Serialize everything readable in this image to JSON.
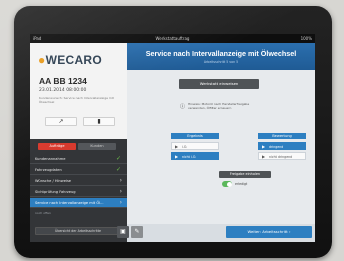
{
  "statusbar": {
    "left": "iPad",
    "center": "Werkstattauftrag",
    "right": "100%"
  },
  "sidebar": {
    "logo_dot": "●",
    "logo_text": "WECARO",
    "plate": "AA BB 1234",
    "date": "23.01.2014 08:00:00",
    "info_text": "Kundenwunsch: Service nach Intervallanzeige mit Ölwechsel",
    "tool_left_icon": "↗",
    "tool_right_icon": "▮",
    "segment_left": "Aufträge",
    "segment_right": "Kunden",
    "items": [
      {
        "label": "Kundenannahme",
        "state": "done"
      },
      {
        "label": "Fahrzeugdaten",
        "state": "done"
      },
      {
        "label": "Wünsche / Hinweise",
        "state": "open"
      },
      {
        "label": "Sichtprüfung Fahrzeug",
        "state": "open"
      },
      {
        "label": "Service nach Intervallanzeige mit Öl...",
        "state": "active"
      }
    ],
    "sub_status": "noch offen",
    "bottom_label": "Übersicht der Arbeitsschritte",
    "check_glyph": "✓",
    "chevron_glyph": "›"
  },
  "main": {
    "title": "Service nach Intervallanzeige mit Ölwechsel",
    "subtitle": "Arbeitsschritt 5 von 5",
    "primary_button": "Werkstatt einweisen",
    "info_icon": "ⓘ",
    "info_text": "Hinweis: Motoröl nach Herstellerfreigabe verwenden, Ölfilter erneuern",
    "left_group": {
      "header": "Ergebnis",
      "options": [
        {
          "label": "i.O.",
          "selected": false
        },
        {
          "label": "nicht i.O.",
          "selected": true
        }
      ]
    },
    "right_group": {
      "header": "Bewertung",
      "options": [
        {
          "label": "dringend",
          "selected": true
        },
        {
          "label": "nicht dringend",
          "selected": false
        }
      ]
    },
    "toggle_header": "Freigabe einholen",
    "toggle_label": "erledigt",
    "toggle_on": true,
    "arrow_glyph": "▶",
    "footer": {
      "camera_icon": "▣",
      "pen_icon": "✎",
      "next_button": "Weiter: Arbeitsschritt ›"
    }
  },
  "colors": {
    "accent_blue": "#2d7fc1",
    "header_blue": "#2b6fae",
    "success_green": "#6cc24a",
    "alert_red": "#d83a2e",
    "sidebar_dark": "#333538"
  }
}
